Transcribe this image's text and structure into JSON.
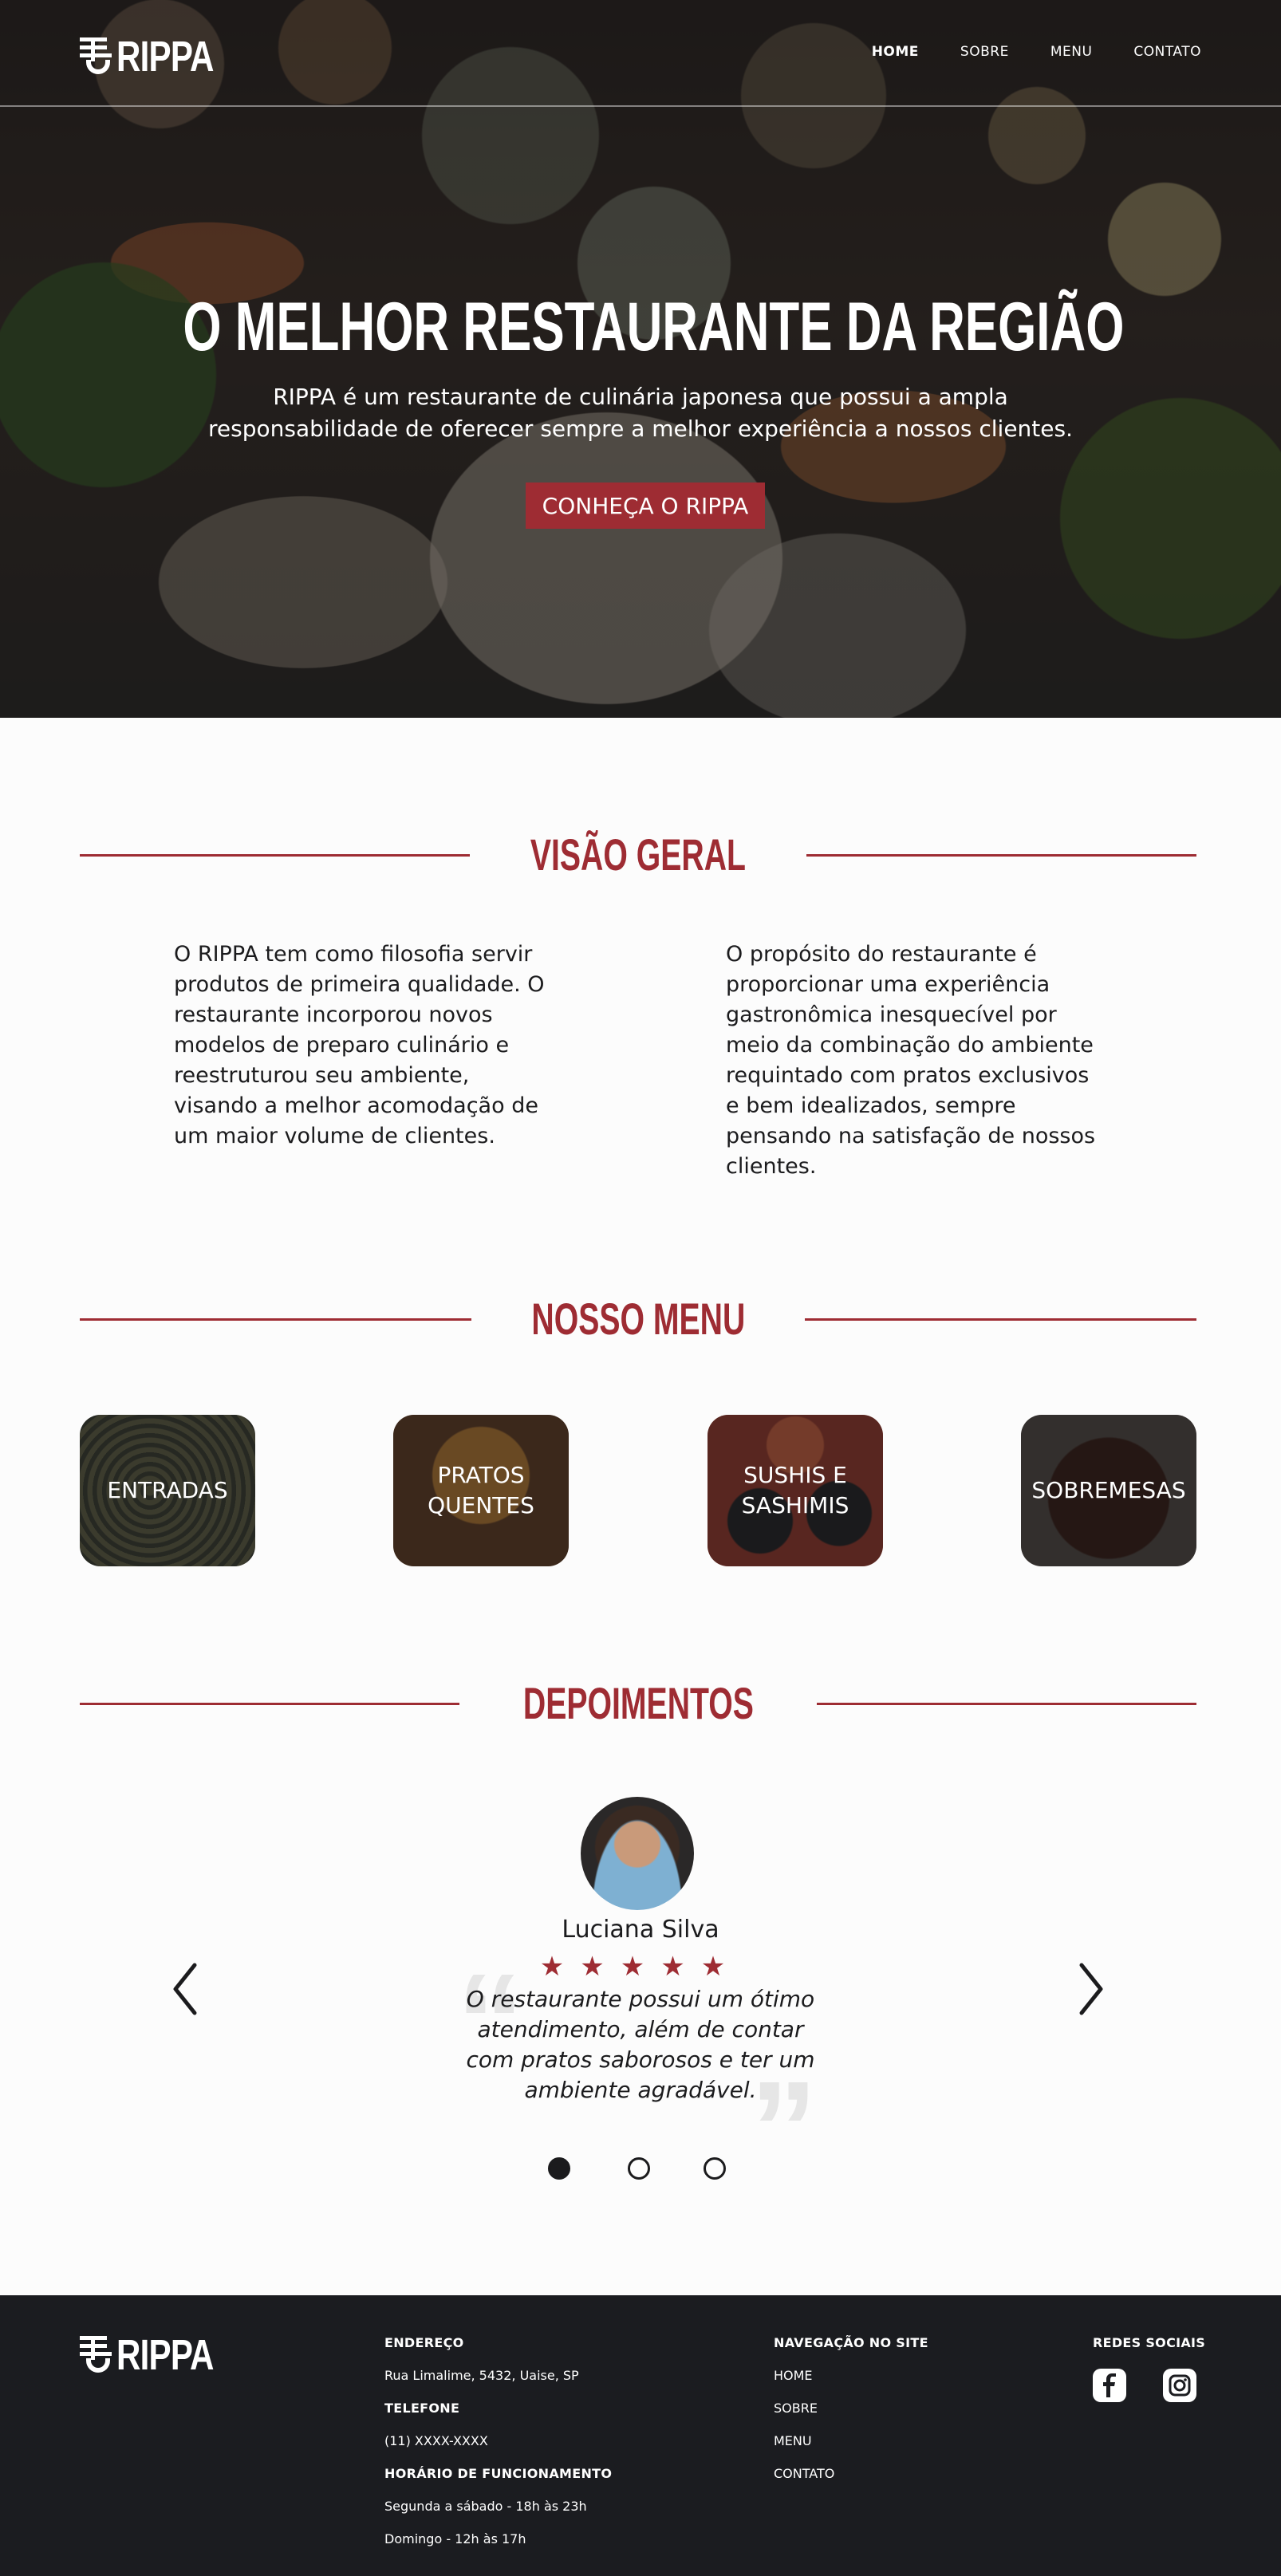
{
  "brand": {
    "name": "RIPPA"
  },
  "nav": {
    "items": [
      "HOME",
      "SOBRE",
      "MENU",
      "CONTATO"
    ],
    "active": "HOME"
  },
  "hero": {
    "title": "O MELHOR RESTAURANTE DA REGIÃO",
    "subtitle": "RIPPA é um restaurante de culinária japonesa que possui a ampla responsabilidade de oferecer sempre a melhor experiência a nossos clientes.",
    "cta": "CONHEÇA O RIPPA"
  },
  "overview": {
    "title": "VISÃO GERAL",
    "left": "O RIPPA tem como filosofia servir produtos de primeira qualidade. O restaurante incorporou novos modelos de preparo culinário e reestruturou seu ambiente, visando a melhor acomodação de um maior volume de clientes.",
    "right": "O propósito do restaurante é proporcionar uma experiência gastronômica inesquecível por meio da combinação do ambiente requintado com pratos exclusivos e bem idealizados, sempre pensando na satisfação de nossos clientes."
  },
  "menu": {
    "title": "NOSSO MENU",
    "items": [
      "ENTRADAS",
      "PRATOS QUENTES",
      "SUSHIS E SASHIMIS",
      "SOBREMESAS"
    ]
  },
  "testimonials": {
    "title": "DEPOIMENTOS",
    "name": "Luciana Silva",
    "stars": "★★★★★",
    "rating": 5,
    "quote": "O restaurante possui um ótimo atendimento, além de contar com pratos saborosos e ter um ambiente agradável.",
    "active_dot": 0
  },
  "footer": {
    "address_label": "ENDEREÇO",
    "address": "Rua Limalime, 5432, Uaise, SP",
    "phone_label": "TELEFONE",
    "phone": "(11) XXXX-XXXX",
    "hours_label": "HORÁRIO DE FUNCIONAMENTO",
    "hours_week": "Segunda a sábado - 18h às 23h",
    "hours_sun": "Domingo - 12h às 17h",
    "nav_label": "NAVEGAÇÃO NO SITE",
    "nav_items": [
      "HOME",
      "SOBRE",
      "MENU",
      "CONTATO"
    ],
    "social_label": "REDES SOCIAIS",
    "social": [
      "facebook-icon",
      "instagram-icon"
    ]
  },
  "colors": {
    "accent": "#9e2c33",
    "footer_bg": "#1b1c20",
    "text": "#1b1b1d"
  }
}
